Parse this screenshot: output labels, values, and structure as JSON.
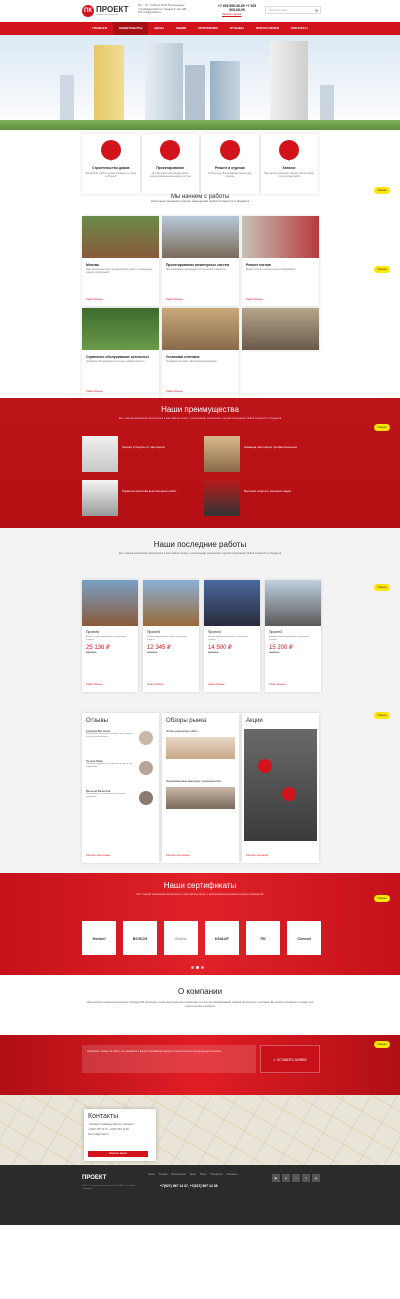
{
  "header": {
    "logo_mark": "ПК",
    "logo_text": "ПРОЕКТ",
    "logo_sub": "строительная компания",
    "info": [
      "Пн. – Пт. с 9:00 до 20:00 без выходных",
      "Стройиндустрия пр-т Ленина 3, оф. 108",
      "Info.msk@proekt.ru"
    ],
    "phone1": "+7 495 555-36-89 +7 925",
    "phone2": "505-08-99",
    "callback": "Заказать звонок",
    "search_placeholder": "Поиск по сайту"
  },
  "nav": {
    "items": [
      "ГЛАВНАЯ",
      "НАШИ РАБОТЫ",
      "ЦЕНЫ",
      "АКЦИИ",
      "ПОРТФОЛИО",
      "ОТЗЫВЫ",
      "ФОТОГАЛЕРЕЯ",
      "КОНТАКТЫ"
    ]
  },
  "features": [
    {
      "title": "Строительство домов",
      "text": "Общий дом любого уровня сложности к сроку в 20 дней"
    },
    {
      "title": "Проектирование",
      "text": "Состав проектной документации: проектирование инженерных систем"
    },
    {
      "title": "Ремонт и отделка",
      "text": "Полностью оборудованная ремонтная отделка"
    },
    {
      "title": "Каталог",
      "text": "Наш каталог включает каталог строительных и отделочных работ"
    }
  ],
  "intro": {
    "title": "Мы начнем с работы",
    "text": "различные решения отделки помещений любой сложности и бюджета"
  },
  "badge": "Новинки",
  "services": [
    {
      "title": "Монтаж",
      "text": "Наш монтаж включает полный комплекс работ по возведению зданий и сооружений",
      "more": "Узнать больше"
    },
    {
      "title": "Проектирование инженерных систем",
      "text": "Проектирование инженерных систем любой сложности",
      "more": "Узнать больше"
    },
    {
      "title": "Ремонт котлов",
      "text": "Ремонт котлов и отопительного оборудования",
      "more": "Узнать больше"
    },
    {
      "title": "Сервисное обслуживание котельных",
      "text": "Сервисное обслуживание котельных любой мощности",
      "more": "Узнать больше"
    },
    {
      "title": "Установка септиков",
      "text": "Установка септиков и автономной канализации",
      "more": "Узнать больше"
    }
  ],
  "advantages": {
    "title": "Наши преимущества",
    "sub": "Мы с вашей компанией настроились в кратчайшие сроки, с различными решениями отделки помещений любой сложности и бюджета",
    "items": [
      "Скидки и бонусы от партнеров",
      "Команда настоящих профессионалов",
      "Гарантия качества выполненных работ",
      "Высокая скорость решения задач"
    ]
  },
  "works": {
    "title": "Наши последние работы",
    "sub": "Мы с вашей компанией настроились в кратчайшие сроки, с различными решениями отделки помещений любой сложности и бюджета",
    "items": [
      {
        "name": "Проект6",
        "text": "Нашим подписчикам проект предложит строить",
        "price": "25 136 ₽",
        "old": "28 700 ₽",
        "more": "Узнать больше"
      },
      {
        "name": "Проект5",
        "text": "Нашим подписчикам проект предложит строить",
        "price": "12 345 ₽",
        "old": "14 500 ₽",
        "more": "Узнать больше"
      },
      {
        "name": "Проект4",
        "text": "Нашим подписчикам проект предложит строить",
        "price": "14 500 ₽",
        "old": "16 000 ₽",
        "more": "Узнать больше"
      },
      {
        "name": "Проект3",
        "text": "Нашим подписчикам проект предложит строить",
        "price": "15 200 ₽",
        "old": "17 500 ₽",
        "more": "Узнать больше"
      }
    ]
  },
  "reviews": {
    "title": "Отзывы",
    "items": [
      {
        "name": "Сибиряк Виктория",
        "text": "Мы остались довольны работой, всё сделали быстро и качественно"
      },
      {
        "name": "Петров Иван",
        "text": "Хорошая компания, всё сделали в срок и без нареканий"
      },
      {
        "name": "Веселов Вячеслав",
        "text": "Рекомендую эту компанию всем своим знакомым"
      }
    ],
    "more": "Смотреть все отзывы"
  },
  "market": {
    "title": "Обзоры рынка",
    "items": [
      "Этапы ремонтных работ",
      "Однокомнатные квартиры: преимущества"
    ],
    "more": "Смотреть все обзоры"
  },
  "promo": {
    "title": "Акции",
    "more": "Смотреть все акции"
  },
  "certs": {
    "title": "Наши сертификаты",
    "sub": "Мы с вашей компанией настроились в кратчайшие сроки, с различными решениями отделки помещений",
    "items": [
      "Henkel",
      "BOSCH",
      "Grohe",
      "KNAUF",
      "ПК",
      "Coresil"
    ]
  },
  "about": {
    "title": "О компании",
    "text": "Наш интернет-магазин предлагает порядка 200 различных типов инструментов и приборов. Количество наименований товаров исчисляется тысячами. Вы можете приобрести товары для строительства и ремонта."
  },
  "request": {
    "placeholder": "Оформите заявку на сайте, мы свяжемся с вами в ближайшее время и ответим на все интересующие вопросы",
    "button": "✔ ОСТАВИТЬ ЗАЯВКУ"
  },
  "contacts": {
    "title": "Контакты",
    "address": "г. Москва, Стройиндустрия пр-т Ленина 3",
    "phone": "+7(927) 567 14 37, +7(927) 567 14 38",
    "email": "Info.msk@proekt.ru",
    "button": "Заказать звонок"
  },
  "footer": {
    "logo": "ПРОЕКТ",
    "menu": [
      "Акции",
      "Отзывы",
      "Фотогалерея",
      "Цены",
      "Наши",
      "Портфолио",
      "Контакты"
    ],
    "phone": "+7(927) 567 14 37, +7(927) 567 14 38",
    "sub": "2017 © Строительная компания ПРОЕКТ, все права защищены"
  },
  "colors": {
    "accent": "#d2131b",
    "badge": "#ffe600",
    "footer": "#2b2b2b"
  }
}
